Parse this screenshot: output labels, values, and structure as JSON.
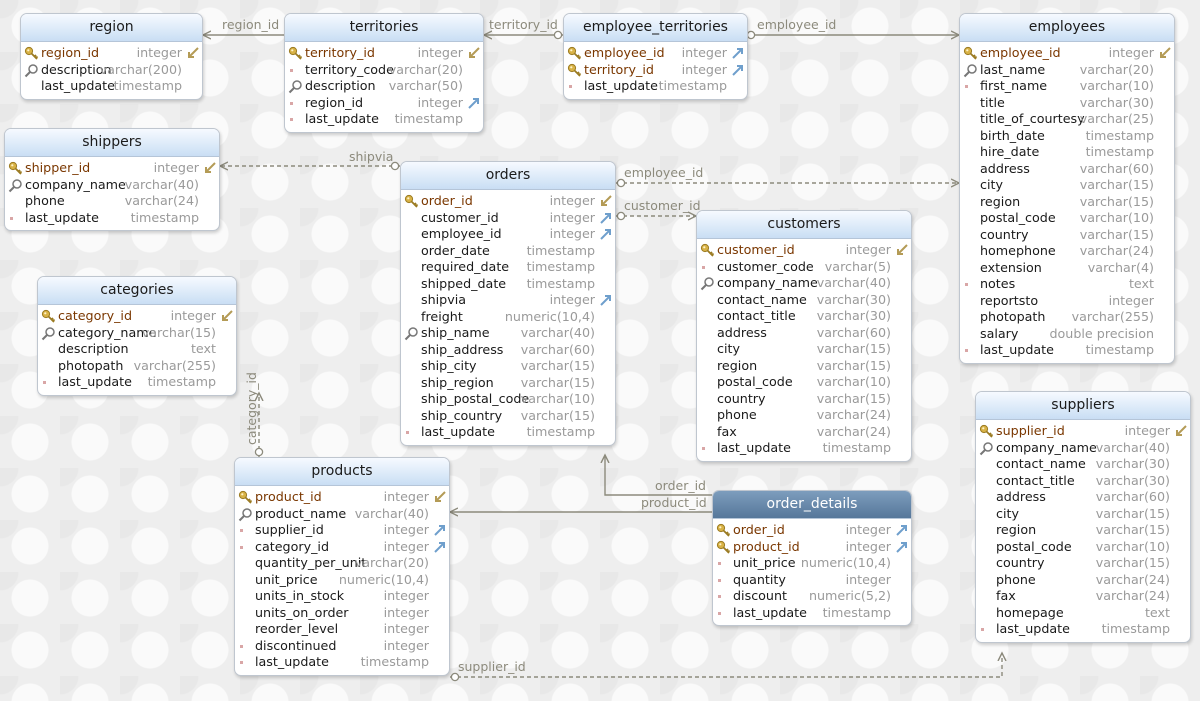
{
  "entities": [
    {
      "id": "region",
      "name": "region",
      "columns": [
        {
          "name": "region_id",
          "type": "integer",
          "pk": true,
          "fk": "self",
          "icon": "key"
        },
        {
          "name": "description",
          "type": "varchar(200)",
          "icon": "search"
        },
        {
          "name": "last_update",
          "type": "timestamp",
          "icon": "none"
        }
      ]
    },
    {
      "id": "territories",
      "name": "territories",
      "columns": [
        {
          "name": "territory_id",
          "type": "integer",
          "pk": true,
          "fk": "self",
          "icon": "key"
        },
        {
          "name": "territory_code",
          "type": "varchar(20)",
          "icon": "dot"
        },
        {
          "name": "description",
          "type": "varchar(50)",
          "icon": "search"
        },
        {
          "name": "region_id",
          "type": "integer",
          "fk": "ref",
          "icon": "dot"
        },
        {
          "name": "last_update",
          "type": "timestamp",
          "icon": "dot"
        }
      ]
    },
    {
      "id": "employee_territories",
      "name": "employee_territories",
      "columns": [
        {
          "name": "employee_id",
          "type": "integer",
          "pk": true,
          "fk": "ref",
          "icon": "key"
        },
        {
          "name": "territory_id",
          "type": "integer",
          "pk": true,
          "fk": "ref",
          "icon": "key"
        },
        {
          "name": "last_update",
          "type": "timestamp",
          "icon": "dot"
        }
      ]
    },
    {
      "id": "employees",
      "name": "employees",
      "columns": [
        {
          "name": "employee_id",
          "type": "integer",
          "pk": true,
          "fk": "self",
          "icon": "key"
        },
        {
          "name": "last_name",
          "type": "varchar(20)",
          "icon": "search"
        },
        {
          "name": "first_name",
          "type": "varchar(10)",
          "icon": "dot"
        },
        {
          "name": "title",
          "type": "varchar(30)",
          "icon": "none"
        },
        {
          "name": "title_of_courtesy",
          "type": "varchar(25)",
          "icon": "none"
        },
        {
          "name": "birth_date",
          "type": "timestamp",
          "icon": "none"
        },
        {
          "name": "hire_date",
          "type": "timestamp",
          "icon": "none"
        },
        {
          "name": "address",
          "type": "varchar(60)",
          "icon": "none"
        },
        {
          "name": "city",
          "type": "varchar(15)",
          "icon": "none"
        },
        {
          "name": "region",
          "type": "varchar(15)",
          "icon": "none"
        },
        {
          "name": "postal_code",
          "type": "varchar(10)",
          "icon": "none"
        },
        {
          "name": "country",
          "type": "varchar(15)",
          "icon": "none"
        },
        {
          "name": "homephone",
          "type": "varchar(24)",
          "icon": "none"
        },
        {
          "name": "extension",
          "type": "varchar(4)",
          "icon": "none"
        },
        {
          "name": "notes",
          "type": "text",
          "icon": "dot"
        },
        {
          "name": "reportsto",
          "type": "integer",
          "icon": "none"
        },
        {
          "name": "photopath",
          "type": "varchar(255)",
          "icon": "none"
        },
        {
          "name": "salary",
          "type": "double precision",
          "icon": "none"
        },
        {
          "name": "last_update",
          "type": "timestamp",
          "icon": "dot"
        }
      ]
    },
    {
      "id": "shippers",
      "name": "shippers",
      "columns": [
        {
          "name": "shipper_id",
          "type": "integer",
          "pk": true,
          "fk": "self",
          "icon": "key"
        },
        {
          "name": "company_name",
          "type": "varchar(40)",
          "icon": "search"
        },
        {
          "name": "phone",
          "type": "varchar(24)",
          "icon": "none"
        },
        {
          "name": "last_update",
          "type": "timestamp",
          "icon": "dot"
        }
      ]
    },
    {
      "id": "orders",
      "name": "orders",
      "columns": [
        {
          "name": "order_id",
          "type": "integer",
          "pk": true,
          "fk": "self",
          "icon": "key"
        },
        {
          "name": "customer_id",
          "type": "integer",
          "fk": "ref",
          "icon": "none"
        },
        {
          "name": "employee_id",
          "type": "integer",
          "fk": "ref",
          "icon": "none"
        },
        {
          "name": "order_date",
          "type": "timestamp",
          "icon": "none"
        },
        {
          "name": "required_date",
          "type": "timestamp",
          "icon": "none"
        },
        {
          "name": "shipped_date",
          "type": "timestamp",
          "icon": "none"
        },
        {
          "name": "shipvia",
          "type": "integer",
          "fk": "ref",
          "icon": "none"
        },
        {
          "name": "freight",
          "type": "numeric(10,4)",
          "icon": "none"
        },
        {
          "name": "ship_name",
          "type": "varchar(40)",
          "icon": "search"
        },
        {
          "name": "ship_address",
          "type": "varchar(60)",
          "icon": "none"
        },
        {
          "name": "ship_city",
          "type": "varchar(15)",
          "icon": "none"
        },
        {
          "name": "ship_region",
          "type": "varchar(15)",
          "icon": "none"
        },
        {
          "name": "ship_postal_code",
          "type": "varchar(10)",
          "icon": "none"
        },
        {
          "name": "ship_country",
          "type": "varchar(15)",
          "icon": "none"
        },
        {
          "name": "last_update",
          "type": "timestamp",
          "icon": "dot"
        }
      ]
    },
    {
      "id": "customers",
      "name": "customers",
      "columns": [
        {
          "name": "customer_id",
          "type": "integer",
          "pk": true,
          "fk": "self",
          "icon": "key"
        },
        {
          "name": "customer_code",
          "type": "varchar(5)",
          "icon": "dot"
        },
        {
          "name": "company_name",
          "type": "varchar(40)",
          "icon": "search"
        },
        {
          "name": "contact_name",
          "type": "varchar(30)",
          "icon": "none"
        },
        {
          "name": "contact_title",
          "type": "varchar(30)",
          "icon": "none"
        },
        {
          "name": "address",
          "type": "varchar(60)",
          "icon": "none"
        },
        {
          "name": "city",
          "type": "varchar(15)",
          "icon": "none"
        },
        {
          "name": "region",
          "type": "varchar(15)",
          "icon": "none"
        },
        {
          "name": "postal_code",
          "type": "varchar(10)",
          "icon": "none"
        },
        {
          "name": "country",
          "type": "varchar(15)",
          "icon": "none"
        },
        {
          "name": "phone",
          "type": "varchar(24)",
          "icon": "none"
        },
        {
          "name": "fax",
          "type": "varchar(24)",
          "icon": "none"
        },
        {
          "name": "last_update",
          "type": "timestamp",
          "icon": "dot"
        }
      ]
    },
    {
      "id": "categories",
      "name": "categories",
      "columns": [
        {
          "name": "category_id",
          "type": "integer",
          "pk": true,
          "fk": "self",
          "icon": "key"
        },
        {
          "name": "category_name",
          "type": "varchar(15)",
          "icon": "search"
        },
        {
          "name": "description",
          "type": "text",
          "icon": "none"
        },
        {
          "name": "photopath",
          "type": "varchar(255)",
          "icon": "none"
        },
        {
          "name": "last_update",
          "type": "timestamp",
          "icon": "dot"
        }
      ]
    },
    {
      "id": "products",
      "name": "products",
      "columns": [
        {
          "name": "product_id",
          "type": "integer",
          "pk": true,
          "fk": "self",
          "icon": "key"
        },
        {
          "name": "product_name",
          "type": "varchar(40)",
          "icon": "search"
        },
        {
          "name": "supplier_id",
          "type": "integer",
          "fk": "ref",
          "icon": "dot"
        },
        {
          "name": "category_id",
          "type": "integer",
          "fk": "ref",
          "icon": "dot"
        },
        {
          "name": "quantity_per_unit",
          "type": "varchar(20)",
          "icon": "none"
        },
        {
          "name": "unit_price",
          "type": "numeric(10,4)",
          "icon": "none"
        },
        {
          "name": "units_in_stock",
          "type": "integer",
          "icon": "none"
        },
        {
          "name": "units_on_order",
          "type": "integer",
          "icon": "none"
        },
        {
          "name": "reorder_level",
          "type": "integer",
          "icon": "none"
        },
        {
          "name": "discontinued",
          "type": "integer",
          "icon": "dot"
        },
        {
          "name": "last_update",
          "type": "timestamp",
          "icon": "dot"
        }
      ]
    },
    {
      "id": "order_details",
      "name": "order_details",
      "selected": true,
      "columns": [
        {
          "name": "order_id",
          "type": "integer",
          "pk": true,
          "fk": "ref",
          "icon": "key"
        },
        {
          "name": "product_id",
          "type": "integer",
          "pk": true,
          "fk": "ref",
          "icon": "key"
        },
        {
          "name": "unit_price",
          "type": "numeric(10,4)",
          "icon": "dot"
        },
        {
          "name": "quantity",
          "type": "integer",
          "icon": "dot"
        },
        {
          "name": "discount",
          "type": "numeric(5,2)",
          "icon": "dot"
        },
        {
          "name": "last_update",
          "type": "timestamp",
          "icon": "dot"
        }
      ]
    },
    {
      "id": "suppliers",
      "name": "suppliers",
      "columns": [
        {
          "name": "supplier_id",
          "type": "integer",
          "pk": true,
          "fk": "self",
          "icon": "key"
        },
        {
          "name": "company_name",
          "type": "varchar(40)",
          "icon": "search"
        },
        {
          "name": "contact_name",
          "type": "varchar(30)",
          "icon": "none"
        },
        {
          "name": "contact_title",
          "type": "varchar(30)",
          "icon": "none"
        },
        {
          "name": "address",
          "type": "varchar(60)",
          "icon": "none"
        },
        {
          "name": "city",
          "type": "varchar(15)",
          "icon": "none"
        },
        {
          "name": "region",
          "type": "varchar(15)",
          "icon": "none"
        },
        {
          "name": "postal_code",
          "type": "varchar(10)",
          "icon": "none"
        },
        {
          "name": "country",
          "type": "varchar(15)",
          "icon": "none"
        },
        {
          "name": "phone",
          "type": "varchar(24)",
          "icon": "none"
        },
        {
          "name": "fax",
          "type": "varchar(24)",
          "icon": "none"
        },
        {
          "name": "homepage",
          "type": "text",
          "icon": "none"
        },
        {
          "name": "last_update",
          "type": "timestamp",
          "icon": "dot"
        }
      ]
    }
  ],
  "relationships": [
    {
      "id": "rel-territories-region",
      "label": "region_id",
      "from": "territories",
      "to": "region",
      "style": "solid"
    },
    {
      "id": "rel-et-territories",
      "label": "territory_id",
      "from": "employee_territories",
      "to": "territories",
      "style": "solid"
    },
    {
      "id": "rel-et-employees",
      "label": "employee_id",
      "from": "employee_territories",
      "to": "employees",
      "style": "solid"
    },
    {
      "id": "rel-orders-shippers",
      "label": "shipvia",
      "from": "orders",
      "to": "shippers",
      "style": "dashed"
    },
    {
      "id": "rel-orders-employees",
      "label": "employee_id",
      "from": "orders",
      "to": "employees",
      "style": "dashed"
    },
    {
      "id": "rel-orders-customers",
      "label": "customer_id",
      "from": "orders",
      "to": "customers",
      "style": "dashed"
    },
    {
      "id": "rel-products-categories",
      "label": "category_id",
      "from": "products",
      "to": "categories",
      "style": "dashed"
    },
    {
      "id": "rel-od-orders",
      "label": "order_id",
      "from": "order_details",
      "to": "orders",
      "style": "solid"
    },
    {
      "id": "rel-od-products",
      "label": "product_id",
      "from": "order_details",
      "to": "products",
      "style": "solid"
    },
    {
      "id": "rel-products-suppliers",
      "label": "supplier_id",
      "from": "products",
      "to": "suppliers",
      "style": "dashed"
    }
  ],
  "colors": {
    "pk_name": "#7a3700",
    "type": "#9a9a9a",
    "header_gradient_top": "#f6faff",
    "header_gradient_bottom": "#c9def4",
    "selected_header": "#6688aa",
    "relationship_line": "#8c8a7c",
    "fk_arrow": "#6f9fcc",
    "fk_self_arrow": "#b49b56",
    "key_icon": "#c9a23a"
  }
}
